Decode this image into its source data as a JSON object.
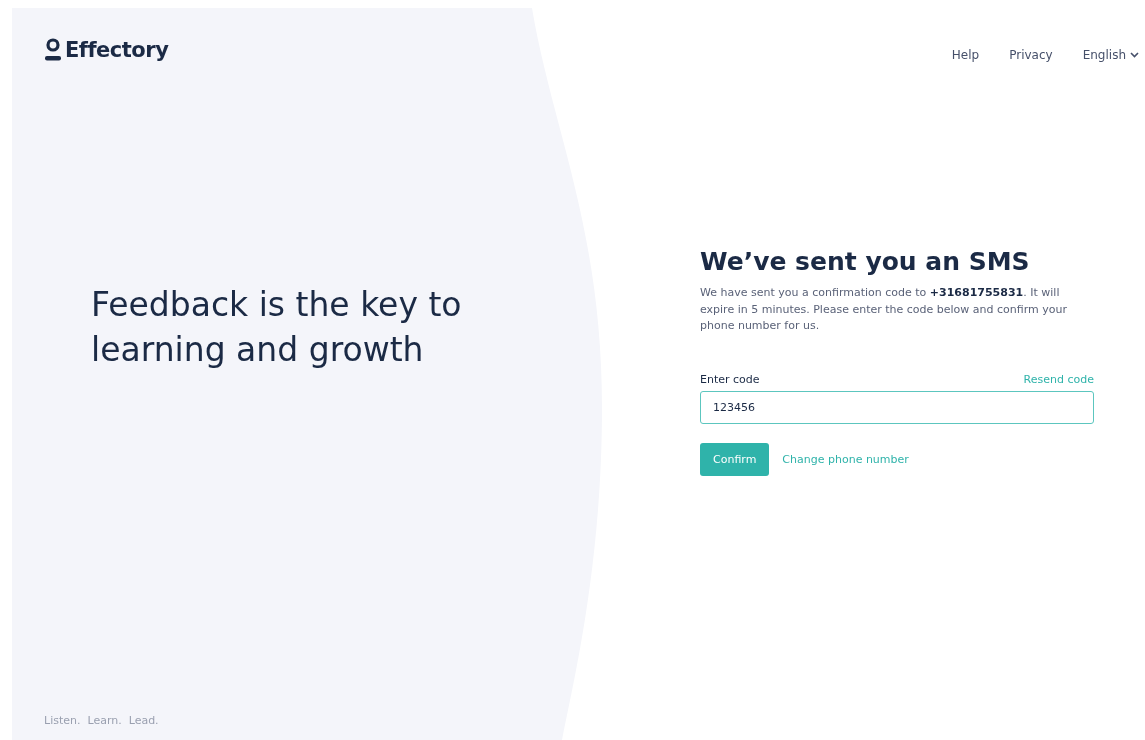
{
  "brand": {
    "name": "Effectory"
  },
  "nav": [
    {
      "label": "Help",
      "kind": "link"
    },
    {
      "label": "Privacy",
      "kind": "link"
    },
    {
      "label": "English",
      "kind": "dropdown"
    }
  ],
  "hero": {
    "headline": "Feedback is the key to learning and growth",
    "tagline": "Listen.  Learn.  Lead."
  },
  "form": {
    "title": "We’ve sent you an SMS",
    "message": "We have sent you a confirmation code to **+31681755831**. It will expire in 5 minutes. Please enter the code below and confirm your phone number for us.",
    "code_label": "Enter code",
    "resend": "Resend code",
    "code_value": "123456",
    "confirm": "Confirm",
    "change": "Change phone number"
  }
}
